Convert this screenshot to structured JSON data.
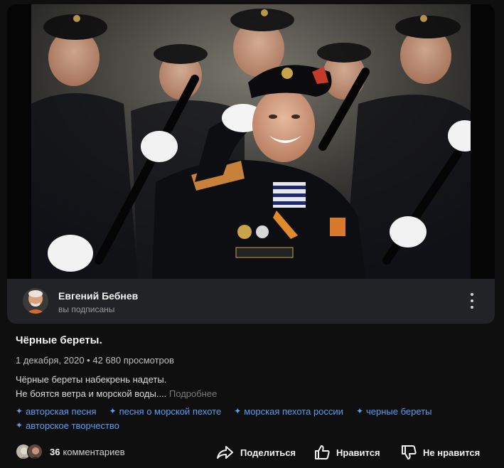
{
  "video": {
    "thumbnail_description_icon": "video-frame-image"
  },
  "author": {
    "name": "Евгений Бебнев",
    "status": "вы подписаны"
  },
  "post": {
    "title": "Чёрные береты.",
    "meta": "1 декабря, 2020 • 42 680 просмотров",
    "description_line1": "Чёрные береты набекрень надеты.",
    "description_line2": "Не боятся ветра и морской воды....",
    "more_label": "Подробнее"
  },
  "tags": [
    "авторская песня",
    "песня о морской пехоте",
    "морская пехота россии",
    "черные береты",
    "авторское творчество"
  ],
  "comments": {
    "count": "36",
    "label": "комментариев"
  },
  "actions": {
    "share": "Поделиться",
    "like": "Нравится",
    "dislike": "Не нравится"
  },
  "colors": {
    "background": "#0f0f0f",
    "card": "#222326",
    "tag": "#5b9cf0"
  }
}
